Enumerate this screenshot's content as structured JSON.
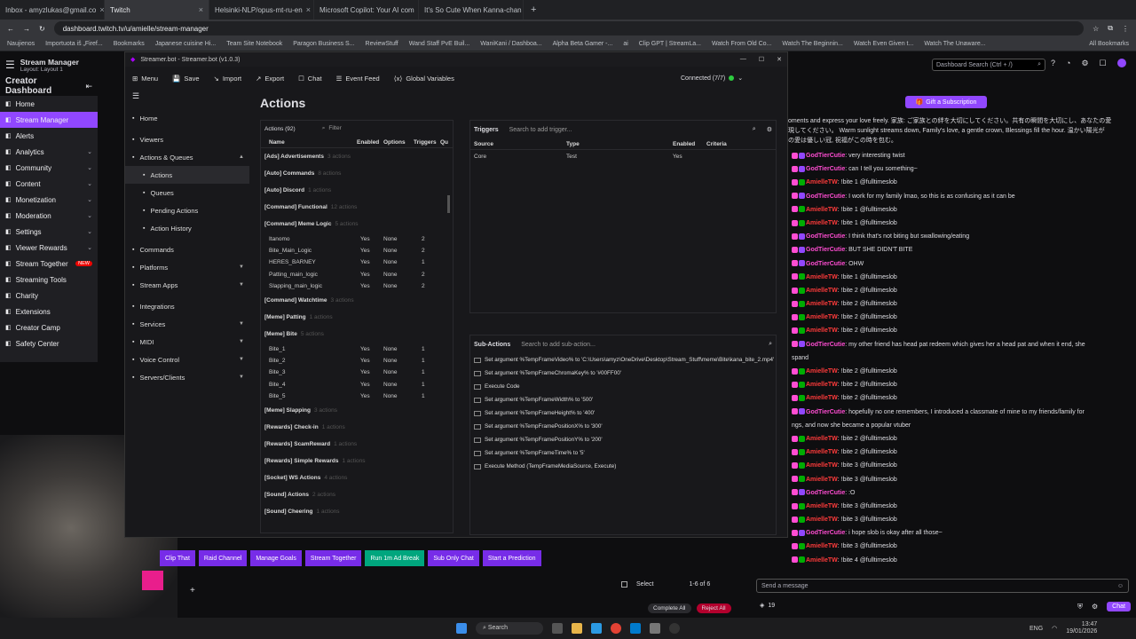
{
  "browser": {
    "tabs": [
      {
        "label": "Inbox - amyzlukas@gmail.co",
        "active": false
      },
      {
        "label": "Twitch",
        "active": true
      },
      {
        "label": "Helsinki-NLP/opus-mt-ru-en",
        "active": false
      },
      {
        "label": "Microsoft Copilot: Your AI com",
        "active": false
      },
      {
        "label": "It's So Cute When Kanna-chan",
        "active": false
      }
    ],
    "url": "dashboard.twitch.tv/u/amielle/stream-manager",
    "bookmarks": [
      "Naujienos",
      "Importuota iš „Firef...",
      "Bookmarks",
      "Japanese cuisine Hi...",
      "Team Site Notebook",
      "Paragon Business S...",
      "ReviewStuff",
      "Wand Staff PvE Buil...",
      "WaniKani / Dashboa...",
      "Alpha Beta Gamer -...",
      "ai",
      "Clip GPT | StreamLa...",
      "Watch From Old Co...",
      "Watch The Beginnin...",
      "Watch Even Given t...",
      "Watch The Unaware...",
      "All Bookmarks"
    ]
  },
  "twitch": {
    "title": "Stream Manager",
    "subtitle": "Layout: Layout 1",
    "section": "Creator Dashboard",
    "nav": [
      {
        "label": "Home",
        "icon": "home-icon",
        "selected": false,
        "chev": false
      },
      {
        "label": "Stream Manager",
        "icon": "stream-icon",
        "selected": true,
        "chev": false
      },
      {
        "label": "Alerts",
        "icon": "alert-icon",
        "selected": false,
        "chev": false
      },
      {
        "label": "Analytics",
        "icon": "analytics-icon",
        "selected": false,
        "chev": true
      },
      {
        "label": "Community",
        "icon": "community-icon",
        "selected": false,
        "chev": true
      },
      {
        "label": "Content",
        "icon": "content-icon",
        "selected": false,
        "chev": true
      },
      {
        "label": "Monetization",
        "icon": "monetization-icon",
        "selected": false,
        "chev": true
      },
      {
        "label": "Moderation",
        "icon": "moderation-icon",
        "selected": false,
        "chev": true
      },
      {
        "label": "Settings",
        "icon": "settings-icon",
        "selected": false,
        "chev": true
      },
      {
        "label": "Viewer Rewards",
        "icon": "rewards-icon",
        "selected": false,
        "chev": true
      },
      {
        "label": "Stream Together",
        "icon": "together-icon",
        "selected": false,
        "chev": false,
        "badge": "NEW"
      },
      {
        "label": "Streaming Tools",
        "icon": "tools-icon",
        "selected": false,
        "chev": false
      },
      {
        "label": "Charity",
        "icon": "charity-icon",
        "selected": false,
        "chev": false
      },
      {
        "label": "Extensions",
        "icon": "extensions-icon",
        "selected": false,
        "chev": false
      },
      {
        "label": "Creator Camp",
        "icon": "camp-icon",
        "selected": false,
        "chev": false
      },
      {
        "label": "Safety Center",
        "icon": "safety-icon",
        "selected": false,
        "chev": false
      }
    ],
    "search_placeholder": "Dashboard Search (Ctrl + /)",
    "gift_label": "Gift a Subscription",
    "chat_placeholder": "Send a message",
    "chat_button": "Chat",
    "points": "19",
    "bottom_buttons": [
      {
        "label": "Clip That",
        "color": "#772ce8"
      },
      {
        "label": "Raid Channel",
        "color": "#772ce8"
      },
      {
        "label": "Manage Goals",
        "color": "#772ce8"
      },
      {
        "label": "Stream Together",
        "color": "#772ce8"
      },
      {
        "label": "Run 1m Ad Break",
        "color": "#00a67e"
      },
      {
        "label": "Sub Only Chat",
        "color": "#772ce8"
      },
      {
        "label": "Start a Prediction",
        "color": "#772ce8"
      }
    ],
    "select_label": "Select",
    "pager": "1-6 of 6",
    "complete_all": "Complete All",
    "reject_all": "Reject All"
  },
  "sb": {
    "title": "Streamer.bot - Streamer.bot (v1.0.3)",
    "menu": [
      "Menu",
      "Save",
      "Import",
      "Export",
      "Chat",
      "Event Feed",
      "Global Variables"
    ],
    "connected": "Connected (7/7)",
    "side": [
      {
        "label": "Home",
        "sub": false,
        "sel": false,
        "chev": ""
      },
      {
        "label": "Viewers",
        "sub": false,
        "sel": false,
        "chev": ""
      },
      {
        "label": "Actions & Queues",
        "sub": false,
        "sel": false,
        "chev": "▲"
      },
      {
        "label": "Actions",
        "sub": true,
        "sel": true,
        "chev": ""
      },
      {
        "label": "Queues",
        "sub": true,
        "sel": false,
        "chev": ""
      },
      {
        "label": "Pending Actions",
        "sub": true,
        "sel": false,
        "chev": ""
      },
      {
        "label": "Action History",
        "sub": true,
        "sel": false,
        "chev": ""
      },
      {
        "label": "Commands",
        "sub": false,
        "sel": false,
        "chev": ""
      },
      {
        "label": "Platforms",
        "sub": false,
        "sel": false,
        "chev": "▼"
      },
      {
        "label": "Stream Apps",
        "sub": false,
        "sel": false,
        "chev": "▼"
      },
      {
        "label": "Integrations",
        "sub": false,
        "sel": false,
        "chev": ""
      },
      {
        "label": "Services",
        "sub": false,
        "sel": false,
        "chev": "▼"
      },
      {
        "label": "MIDI",
        "sub": false,
        "sel": false,
        "chev": "▼"
      },
      {
        "label": "Voice Control",
        "sub": false,
        "sel": false,
        "chev": "▼"
      },
      {
        "label": "Servers/Clients",
        "sub": false,
        "sel": false,
        "chev": "▼"
      }
    ],
    "page_title": "Actions",
    "actions_count": "Actions (92)",
    "filter_placeholder": "Filter",
    "columns": [
      "Name",
      "Enabled",
      "Options",
      "Triggers",
      "Qu"
    ],
    "groups": [
      {
        "name": "[Ads] Advertisements",
        "count": "3 actions",
        "rows": []
      },
      {
        "name": "[Auto] Commands",
        "count": "8 actions",
        "rows": []
      },
      {
        "name": "[Auto] Discord",
        "count": "1 actions",
        "rows": []
      },
      {
        "name": "[Command] Functional",
        "count": "12 actions",
        "rows": []
      },
      {
        "name": "[Command] Meme Logic",
        "count": "5 actions",
        "rows": [
          [
            "Itanomo",
            "Yes",
            "None",
            "2"
          ],
          [
            "Bite_Main_Logic",
            "Yes",
            "None",
            "2"
          ],
          [
            "HERES_BARNEY",
            "Yes",
            "None",
            "1"
          ],
          [
            "Patting_main_logic",
            "Yes",
            "None",
            "2"
          ],
          [
            "Slapping_main_logic",
            "Yes",
            "None",
            "2"
          ]
        ]
      },
      {
        "name": "[Command] Watchtime",
        "count": "3 actions",
        "rows": []
      },
      {
        "name": "[Meme] Patting",
        "count": "1 actions",
        "rows": []
      },
      {
        "name": "[Meme] Bite",
        "count": "5 actions",
        "rows": [
          [
            "Bite_1",
            "Yes",
            "None",
            "1"
          ],
          [
            "Bite_2",
            "Yes",
            "None",
            "1"
          ],
          [
            "Bite_3",
            "Yes",
            "None",
            "1"
          ],
          [
            "Bite_4",
            "Yes",
            "None",
            "1"
          ],
          [
            "Bite_5",
            "Yes",
            "None",
            "1"
          ]
        ]
      },
      {
        "name": "[Meme] Slapping",
        "count": "3 actions",
        "rows": []
      },
      {
        "name": "[Rewards] Check-in",
        "count": "1 actions",
        "rows": []
      },
      {
        "name": "[Rewards] ScamReward",
        "count": "1 actions",
        "rows": []
      },
      {
        "name": "[Rewards] Simple Rewards",
        "count": "1 actions",
        "rows": []
      },
      {
        "name": "[Socket] WS Actions",
        "count": "4 actions",
        "rows": []
      },
      {
        "name": "[Sound] Actions",
        "count": "2 actions",
        "rows": []
      },
      {
        "name": "[Sound] Cheering",
        "count": "1 actions",
        "rows": []
      }
    ],
    "triggers_label": "Triggers",
    "triggers_placeholder": "Search to add trigger...",
    "trigger_columns": [
      "Source",
      "Type",
      "Enabled",
      "Criteria"
    ],
    "trigger_rows": [
      [
        "Core",
        "Test",
        "Yes",
        ""
      ]
    ],
    "subactions_label": "Sub-Actions",
    "subactions_placeholder": "Search to add sub-action...",
    "subactions": [
      "Set argument %TempFrameVideo% to 'C:\\Users\\amyz\\OneDrive\\Desktop\\Stream_Stuff\\meme\\Bite\\kana_bite_2.mp4'",
      "Set argument %TempFrameChromaKey% to '#00FF00'",
      "Execute Code",
      "Set argument %TempFrameWidth% to '500'",
      "Set argument %TempFrameHeight% to '400'",
      "Set argument %TempFramePositionX% to '300'",
      "Set argument %TempFramePositionY% to '200'",
      "Set argument %TempFrameTime% to '5'",
      "Execute Method (TempFrameMediaSource, Execute)"
    ]
  },
  "chat": {
    "top_text": "oments and express your love freely. 家族: ご家族との絆を大切にしてください。共有の瞬間を大切にし、あなたの愛",
    "top_text2": "現してください。 Warm sunlight streams down, Family's love, a gentle crown, Blessings fill the hour. 温かい陽光が",
    "top_text3": "の愛は優しい冠, 祝福がこの時を包む。",
    "messages": [
      {
        "user": "GodTierCutie",
        "text": "very interesting twist",
        "cls": "u1"
      },
      {
        "user": "GodTierCutie",
        "text": "can I tell you something~",
        "cls": "u1"
      },
      {
        "user": "AmielleTW",
        "text": "!bite 1 @fulltimeslob",
        "cls": "u2"
      },
      {
        "user": "GodTierCutie",
        "text": "I work for my family lmao, so this is as confusing as it can be",
        "cls": "u1"
      },
      {
        "user": "AmielleTW",
        "text": "!bite 1 @fulltimeslob",
        "cls": "u2"
      },
      {
        "user": "AmielleTW",
        "text": "!bite 1 @fulltimeslob",
        "cls": "u2"
      },
      {
        "user": "GodTierCutie",
        "text": "I think that's not biting but swallowing/eating",
        "cls": "u1"
      },
      {
        "user": "GodTierCutie",
        "text": "BUT SHE DIDN'T BITE",
        "cls": "u1"
      },
      {
        "user": "GodTierCutie",
        "text": "OHW",
        "cls": "u1"
      },
      {
        "user": "AmielleTW",
        "text": "!bite 1 @fulltimeslob",
        "cls": "u2"
      },
      {
        "user": "AmielleTW",
        "text": "!bite 2 @fulltimeslob",
        "cls": "u2"
      },
      {
        "user": "AmielleTW",
        "text": "!bite 2 @fulltimeslob",
        "cls": "u2"
      },
      {
        "user": "AmielleTW",
        "text": "!bite 2 @fulltimeslob",
        "cls": "u2"
      },
      {
        "user": "AmielleTW",
        "text": "!bite 2 @fulltimeslob",
        "cls": "u2"
      },
      {
        "user": "GodTierCutie",
        "text": "my other friend has head pat redeem which gives her a head pat and when it end, she",
        "cls": "u1"
      },
      {
        "user": "",
        "text": "spand",
        "cls": "u1"
      },
      {
        "user": "AmielleTW",
        "text": "!bite 2 @fulltimeslob",
        "cls": "u2"
      },
      {
        "user": "AmielleTW",
        "text": "!bite 2 @fulltimeslob",
        "cls": "u2"
      },
      {
        "user": "AmielleTW",
        "text": "!bite 2 @fulltimeslob",
        "cls": "u2"
      },
      {
        "user": "GodTierCutie",
        "text": "hopefully no one remembers, I introduced a classmate of mine to my friends/family for",
        "cls": "u1"
      },
      {
        "user": "",
        "text": "ngs, and now she became a popular vtuber",
        "cls": "u1"
      },
      {
        "user": "AmielleTW",
        "text": "!bite 2 @fulltimeslob",
        "cls": "u2"
      },
      {
        "user": "AmielleTW",
        "text": "!bite 2 @fulltimeslob",
        "cls": "u2"
      },
      {
        "user": "AmielleTW",
        "text": "!bite 3 @fulltimeslob",
        "cls": "u2"
      },
      {
        "user": "AmielleTW",
        "text": "!bite 3 @fulltimeslob",
        "cls": "u2"
      },
      {
        "user": "GodTierCutie",
        "text": ":O",
        "cls": "u1"
      },
      {
        "user": "AmielleTW",
        "text": "!bite 3 @fulltimeslob",
        "cls": "u2"
      },
      {
        "user": "AmielleTW",
        "text": "!bite 3 @fulltimeslob",
        "cls": "u2"
      },
      {
        "user": "GodTierCutie",
        "text": "i hope slob is okay after all those~",
        "cls": "u1"
      },
      {
        "user": "AmielleTW",
        "text": "!bite 3 @fulltimeslob",
        "cls": "u2"
      },
      {
        "user": "AmielleTW",
        "text": "!bite 4 @fulltimeslob",
        "cls": "u2"
      }
    ]
  },
  "taskbar": {
    "search": "Search",
    "lang": "ENG",
    "time": "13:47",
    "date": "19/01/2026"
  },
  "colors": {
    "accent": "#9147ff",
    "green": "#00a67e"
  }
}
